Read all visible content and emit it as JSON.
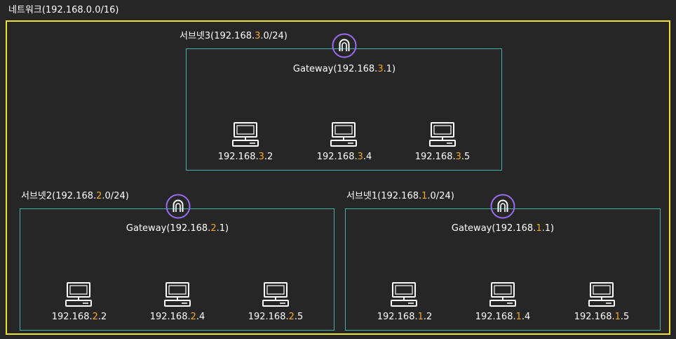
{
  "network": {
    "title": "네트워크(192.168.0.0/16)"
  },
  "colors": {
    "frame": "#f0e030",
    "subnet_border": "#3fb3aa",
    "router": "#9b6cf0",
    "octet_highlight": "#f5a623"
  },
  "subnets": [
    {
      "name": "서브넷3",
      "label_pre": "서브넷3(192.168.",
      "octet": "3",
      "label_post": ".0/24)",
      "gateway_pre": "Gateway(192.168.",
      "gateway_post": ".1)",
      "hosts": [
        {
          "pre": "192.168.",
          "octet": "3",
          "post": ".2"
        },
        {
          "pre": "192.168.",
          "octet": "3",
          "post": ".4"
        },
        {
          "pre": "192.168.",
          "octet": "3",
          "post": ".5"
        }
      ]
    },
    {
      "name": "서브넷2",
      "label_pre": "서브넷2(192.168.",
      "octet": "2",
      "label_post": ".0/24)",
      "gateway_pre": "Gateway(192.168.",
      "gateway_post": ".1)",
      "hosts": [
        {
          "pre": "192.168.",
          "octet": "2",
          "post": ".2"
        },
        {
          "pre": "192.168.",
          "octet": "2",
          "post": ".4"
        },
        {
          "pre": "192.168.",
          "octet": "2",
          "post": ".5"
        }
      ]
    },
    {
      "name": "서브넷1",
      "label_pre": "서브넷1(192.168.",
      "octet": "1",
      "label_post": ".0/24)",
      "gateway_pre": "Gateway(192.168.",
      "gateway_post": ".1)",
      "hosts": [
        {
          "pre": "192.168.",
          "octet": "1",
          "post": ".2"
        },
        {
          "pre": "192.168.",
          "octet": "1",
          "post": ".4"
        },
        {
          "pre": "192.168.",
          "octet": "1",
          "post": ".5"
        }
      ]
    }
  ],
  "icons": {
    "gateway": "router-icon",
    "host": "computer-icon"
  }
}
